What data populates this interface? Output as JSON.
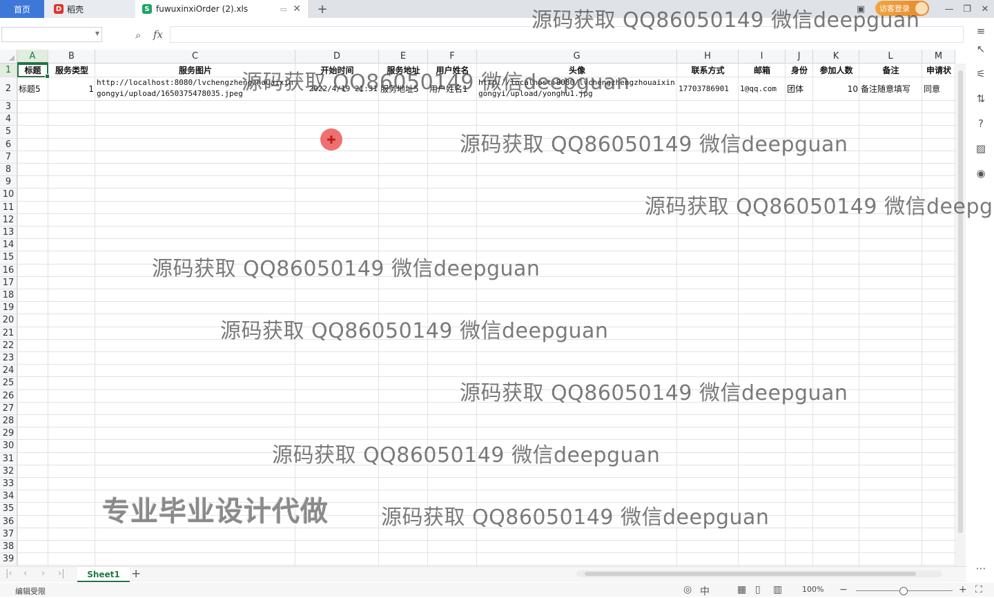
{
  "titlebar": {
    "home_tab": "首页",
    "docer_tab": "稻壳",
    "file_tab": "fuwuxinxiOrder (2).xls",
    "visitor_login": "访客登录"
  },
  "formula_bar": {
    "name_box": "",
    "fx_label": "fx",
    "formula": ""
  },
  "sheet": {
    "columns": [
      "A",
      "B",
      "C",
      "D",
      "E",
      "F",
      "G",
      "H",
      "I",
      "J",
      "K",
      "L",
      "M"
    ],
    "row_numbers": [
      "1",
      "2",
      "3",
      "4",
      "5",
      "6",
      "7",
      "8",
      "9",
      "10",
      "11",
      "12",
      "13",
      "14",
      "15",
      "16",
      "17",
      "18",
      "19",
      "20",
      "21",
      "22",
      "23",
      "24",
      "25",
      "26",
      "27",
      "28",
      "29",
      "30",
      "31",
      "32",
      "33",
      "34",
      "35",
      "36",
      "37",
      "38",
      "39"
    ],
    "headers": [
      "标题",
      "服务类型",
      "服务图片",
      "开始时间",
      "服务地址",
      "用户姓名",
      "头像",
      "联系方式",
      "邮箱",
      "身份",
      "参加人数",
      "备注",
      "申请状"
    ],
    "row2": {
      "title": "标题5",
      "type": "1",
      "image": "http://localhost:8080/lvchengzhengzhouaixingongyi/upload/1650375478035.jpeg",
      "start_time": "2022/4/19 21:31",
      "address": "服务地址5",
      "user_name": "用户姓名1",
      "avatar": "http://localhost:8080/lvchengzhengzhouaixingongyi/upload/yonghu1.jpg",
      "phone": "17703786901",
      "email": "1@qq.com",
      "identity": "团体",
      "participants": "10",
      "remark": "备注随意填写",
      "status": "同意"
    }
  },
  "sheet_tabs": {
    "active": "Sheet1"
  },
  "status_bar": {
    "left_text": "编辑受限",
    "zoom": "100%"
  },
  "overlays": {
    "watermark": "源码获取 QQ86050149 微信deepguan",
    "promo": "专业毕业设计代做"
  },
  "colors": {
    "accent_green": "#217346",
    "home_tab_blue": "#3d78d8",
    "login_orange": "#e8862a"
  }
}
